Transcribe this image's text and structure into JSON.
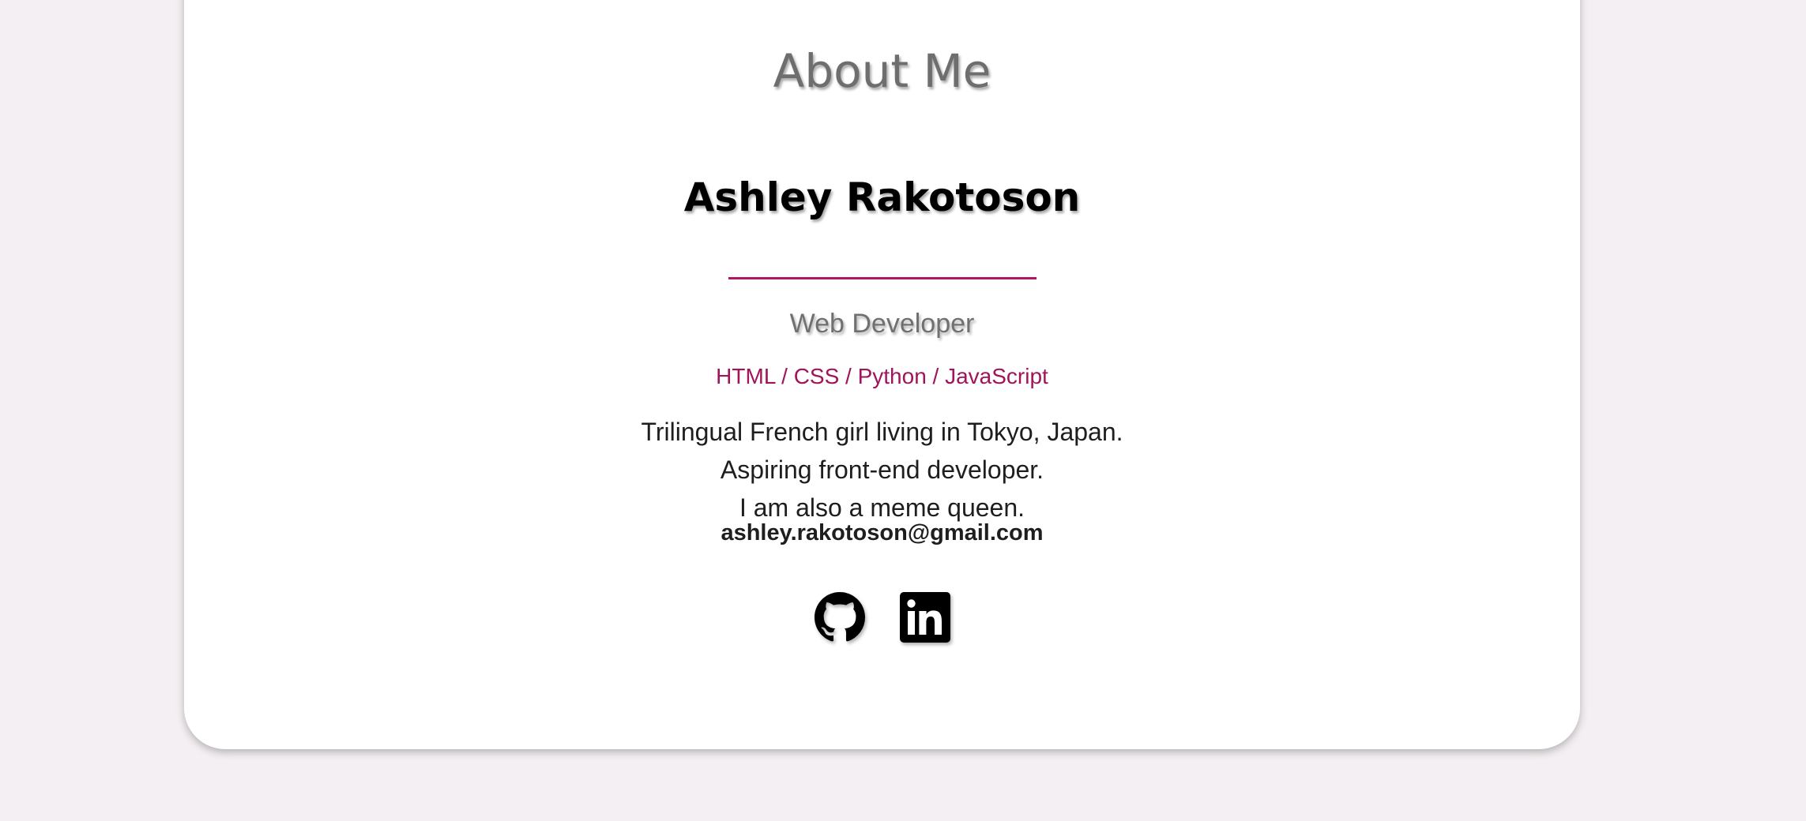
{
  "section": {
    "title": "About Me"
  },
  "profile": {
    "name": "Ashley Rakotoson",
    "role": "Web Developer",
    "skills": "HTML / CSS / Python / JavaScript",
    "bio": [
      "Trilingual French girl living in Tokyo, Japan.",
      "Aspiring front-end developer.",
      "I am also a meme queen."
    ],
    "email": "ashley.rakotoson@gmail.com"
  },
  "socials": [
    {
      "icon": "github-icon"
    },
    {
      "icon": "linkedin-icon"
    }
  ],
  "colors": {
    "background": "#f3eff2",
    "card": "#ffffff",
    "accent": "#a0145a",
    "title_gray": "#6e6e6e",
    "text": "#1e1e1e"
  }
}
